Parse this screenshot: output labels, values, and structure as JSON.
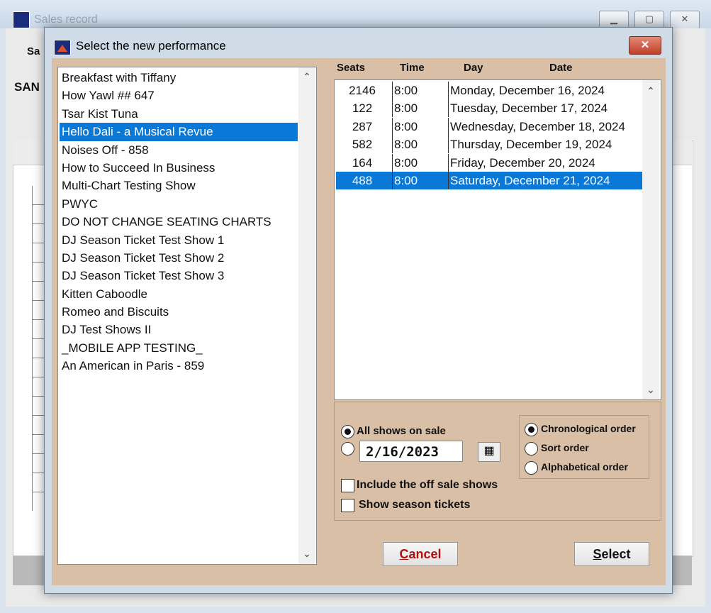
{
  "background_window": {
    "title": "Sales record",
    "label_partial": "Sa",
    "heading_partial": "SAN"
  },
  "dialog": {
    "title": "Select the new performance",
    "close_label": "✕"
  },
  "shows": {
    "items": [
      "Breakfast with Tiffany",
      "How Yawl ## 647",
      "Tsar Kist Tuna",
      "Hello Dali - a Musical Revue",
      "Noises Off - 858",
      "How to Succeed In Business",
      "Multi-Chart Testing Show",
      "PWYC",
      "DO NOT CHANGE SEATING CHARTS",
      "DJ Season Ticket Test Show 1",
      "DJ Season Ticket Test Show 2",
      "DJ Season Ticket Test Show 3",
      "Kitten Caboodle",
      "Romeo and Biscuits",
      "DJ Test Shows II",
      "_MOBILE APP TESTING_",
      "An American in Paris - 859"
    ],
    "selected_index": 3
  },
  "performances": {
    "headers": {
      "seats": "Seats",
      "time": "Time",
      "day": "Day",
      "date": "Date"
    },
    "rows": [
      {
        "seats": "2146",
        "time": "8:00",
        "date": "Monday, December 16, 2024"
      },
      {
        "seats": "122",
        "time": "8:00",
        "date": "Tuesday, December 17, 2024"
      },
      {
        "seats": "287",
        "time": "8:00",
        "date": "Wednesday, December 18, 2024"
      },
      {
        "seats": "582",
        "time": "8:00",
        "date": "Thursday, December 19, 2024"
      },
      {
        "seats": "164",
        "time": "8:00",
        "date": "Friday, December 20, 2024"
      },
      {
        "seats": "488",
        "time": "8:00",
        "date": "Saturday, December 21, 2024"
      }
    ],
    "selected_index": 5
  },
  "options": {
    "all_shows_label": "All shows on sale",
    "date_value": "2/16/2023",
    "include_off_sale_label": "Include the off sale shows",
    "season_tickets_label": "Show season tickets",
    "sort": {
      "chronological": "Chronological order",
      "sort_order": "Sort order",
      "alphabetical": "Alphabetical order"
    }
  },
  "buttons": {
    "cancel_first": "C",
    "cancel_rest": "ancel",
    "select_first": "S",
    "select_rest": "elect"
  },
  "icons": {
    "scroll_up": "⌃",
    "scroll_down": "⌄",
    "calendar": "▦"
  },
  "colors": {
    "selection": "#0a78d7",
    "dialog_client": "#d8bfa6",
    "close_button": "#c0402a"
  }
}
